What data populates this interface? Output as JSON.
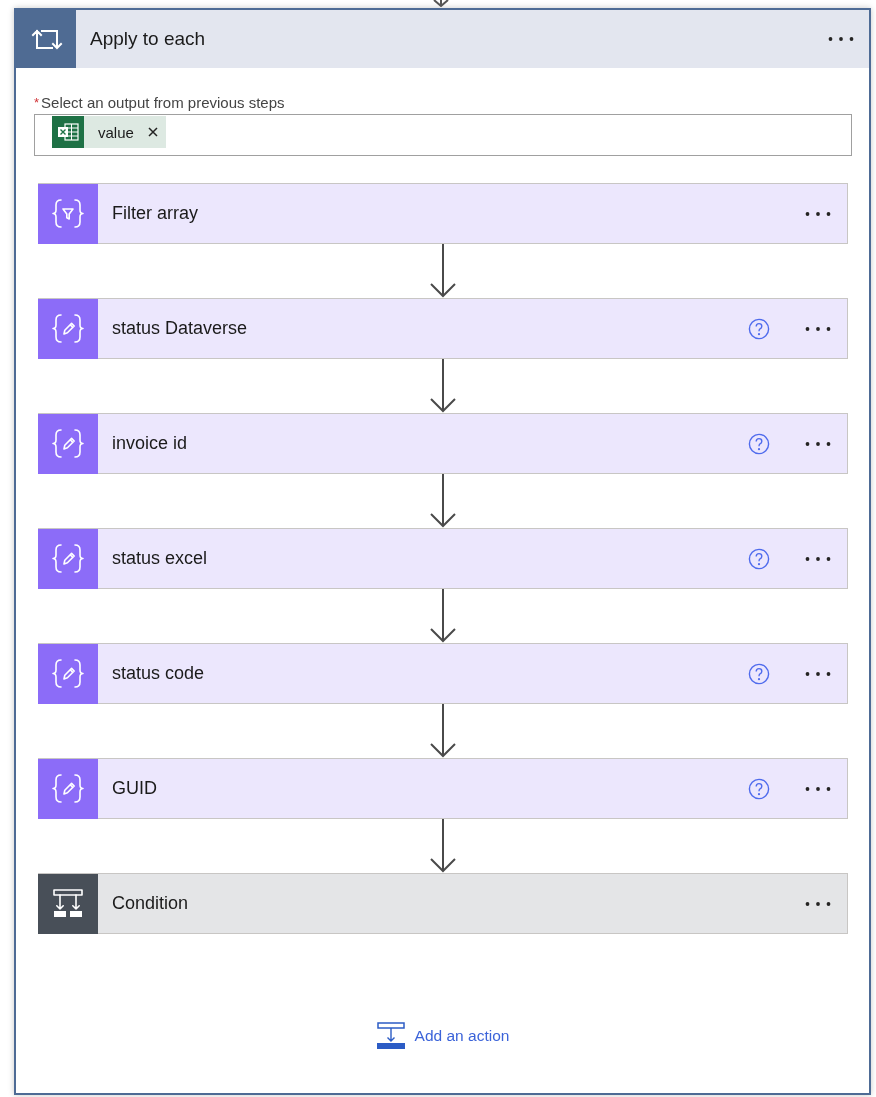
{
  "scope": {
    "title": "Apply to each",
    "input": {
      "required_mark": "*",
      "label": "Select an output from previous steps",
      "tokens": [
        {
          "text": "value"
        }
      ]
    }
  },
  "actions": [
    {
      "kind": "filter",
      "title": "Filter array",
      "help": false
    },
    {
      "kind": "compose",
      "title": "status Dataverse",
      "help": true
    },
    {
      "kind": "compose",
      "title": "invoice id",
      "help": true
    },
    {
      "kind": "compose",
      "title": "status excel",
      "help": true
    },
    {
      "kind": "compose",
      "title": "status code",
      "help": true
    },
    {
      "kind": "compose",
      "title": "GUID",
      "help": true
    },
    {
      "kind": "condition",
      "title": "Condition",
      "help": false
    }
  ],
  "add_action": {
    "label": "Add an action"
  }
}
